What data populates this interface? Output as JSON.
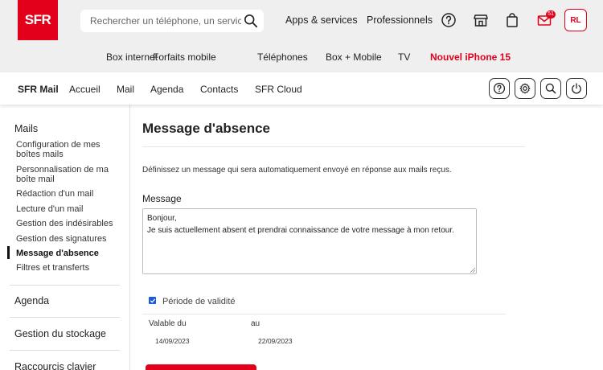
{
  "header": {
    "logo_text": "SFR",
    "search_placeholder": "Rechercher un téléphone, un service, ...",
    "links": {
      "apps": "Apps & services",
      "pro": "Professionnels"
    },
    "mail_badge": "51",
    "avatar_initials": "RL",
    "nav": [
      "Box internet",
      "Forfaits mobile",
      "Téléphones",
      "Box + Mobile",
      "TV",
      "Nouvel iPhone 15"
    ]
  },
  "mailbar": {
    "brand": "SFR Mail",
    "links": [
      "Accueil",
      "Mail",
      "Agenda",
      "Contacts",
      "SFR Cloud"
    ]
  },
  "sidebar": {
    "mails_heading": "Mails",
    "mail_items": [
      "Configuration de mes boîtes mails",
      "Personnalisation de ma boîte mail",
      "Rédaction d'un mail",
      "Lecture d'un mail",
      "Gestion des indésirables",
      "Gestion des signatures",
      "Message d'absence",
      "Filtres et transferts"
    ],
    "sections": [
      "Agenda",
      "Gestion du stockage",
      "Raccourcis clavier"
    ]
  },
  "content": {
    "title": "Message d'absence",
    "description": "Définissez un message qui sera automatiquement envoyé en réponse aux mails reçus.",
    "message_label": "Message",
    "message_value": "Bonjour,\nJe suis actuellement absent et prendrai connaissance de votre message à mon retour.",
    "validity_label": "Période de validité",
    "validity_checked": true,
    "from_label": "Valable du",
    "to_label": "au",
    "from_value": "14/09/2023",
    "to_value": "22/09/2023"
  },
  "colors": {
    "brand_red": "#e2001a",
    "checkbox_blue": "#1a5bd8"
  }
}
